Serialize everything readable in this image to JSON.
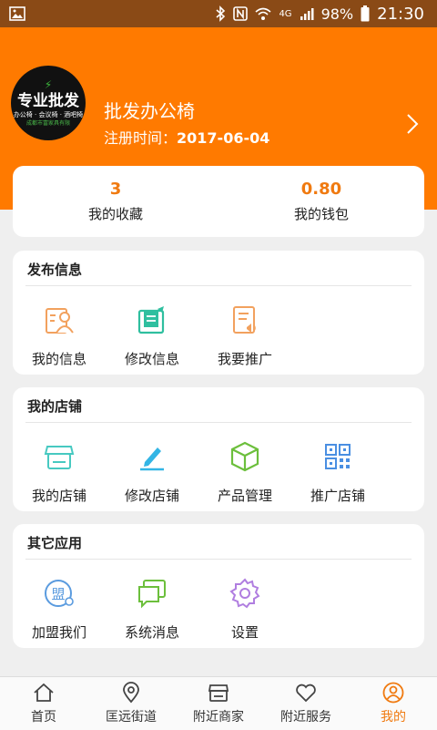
{
  "status_bar": {
    "signal_type": "4G",
    "battery": "98%",
    "time": "21:30"
  },
  "profile": {
    "name": "批发办公椅",
    "reg_label": "注册时间：",
    "reg_date": "2017-06-04",
    "logo_text": "专业批发",
    "logo_sub": "办公椅 · 会议椅 · 酒吧椅",
    "logo_company": "成都市富家具有限"
  },
  "stats": [
    {
      "value": "3",
      "label": "我的收藏"
    },
    {
      "value": "0.80",
      "label": "我的钱包"
    }
  ],
  "sections": [
    {
      "title": "发布信息",
      "items": [
        {
          "label": "我的信息",
          "icon": "profile-card-icon"
        },
        {
          "label": "修改信息",
          "icon": "edit-document-icon"
        },
        {
          "label": "我要推广",
          "icon": "promote-document-icon"
        }
      ]
    },
    {
      "title": "我的店铺",
      "items": [
        {
          "label": "我的店铺",
          "icon": "shop-icon"
        },
        {
          "label": "修改店铺",
          "icon": "pen-icon"
        },
        {
          "label": "产品管理",
          "icon": "box-icon"
        },
        {
          "label": "推广店铺",
          "icon": "qr-code-icon"
        }
      ]
    },
    {
      "title": "其它应用",
      "items": [
        {
          "label": "加盟我们",
          "icon": "join-icon",
          "glyph": "盟"
        },
        {
          "label": "系统消息",
          "icon": "message-icon"
        },
        {
          "label": "设置",
          "icon": "gear-icon"
        }
      ]
    }
  ],
  "tabs": [
    {
      "label": "首页",
      "icon": "home-icon"
    },
    {
      "label": "匡远街道",
      "icon": "location-pin-icon"
    },
    {
      "label": "附近商家",
      "icon": "store-icon"
    },
    {
      "label": "附近服务",
      "icon": "heart-icon"
    },
    {
      "label": "我的",
      "icon": "user-icon",
      "active": true
    }
  ],
  "colors": {
    "brand": "#ff7a00",
    "accent_text": "#f07a10",
    "status_bar": "#8a4a16"
  }
}
